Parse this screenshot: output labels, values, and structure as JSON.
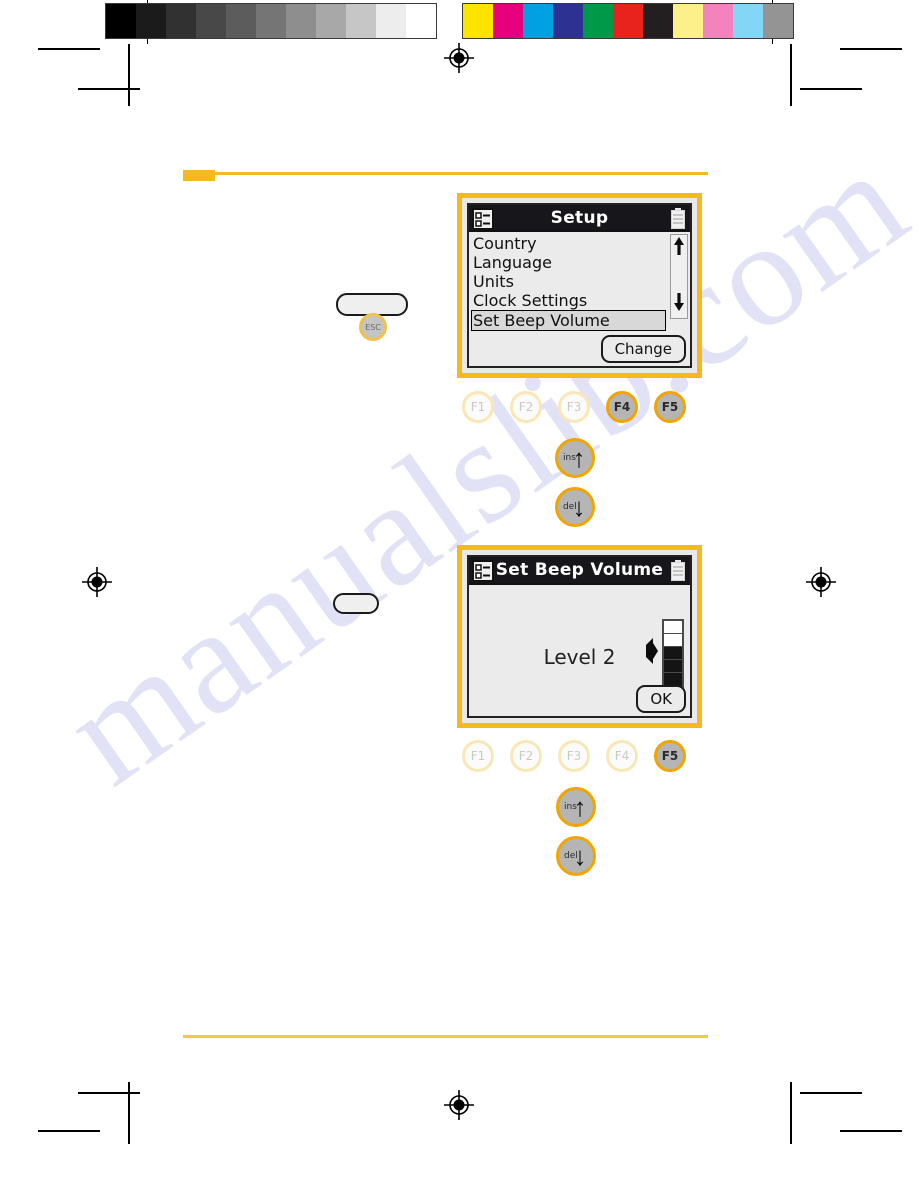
{
  "page": {
    "watermark_text": "manualslib.com"
  },
  "calibration": {
    "gray_swatches": [
      "#000000",
      "#1b1b1b",
      "#313131",
      "#484848",
      "#5c5c5c",
      "#757575",
      "#8e8e8e",
      "#a8a8a8",
      "#c6c6c6",
      "#ededed",
      "#ffffff"
    ],
    "color_swatches": [
      "#fde300",
      "#e6007e",
      "#00a0e3",
      "#2e3192",
      "#009949",
      "#e8221d",
      "#231f20",
      "#fcf08a",
      "#f283bd",
      "#84d6f7",
      "#949494"
    ]
  },
  "accent": {
    "yellow_rule": "#f5b820",
    "yellow_rule_bottom": "#f2cb3d",
    "device_frame": "#f5b820",
    "key_ring_active": "#f0a500",
    "key_ring_dim": "#fae7b4"
  },
  "screen1": {
    "title": "Setup",
    "icon_left": "checklist-icon",
    "icon_right": "battery-icon",
    "menu_items": [
      {
        "label": "Country",
        "selected": false
      },
      {
        "label": "Language",
        "selected": false
      },
      {
        "label": "Units",
        "selected": false
      },
      {
        "label": "Clock Settings",
        "selected": false
      },
      {
        "label": "Set Beep Volume",
        "selected": true
      }
    ],
    "scroll_up": "scroll-up-arrow",
    "scroll_down": "scroll-down-arrow",
    "softkey": "Change"
  },
  "screen2": {
    "title": "Set Beep Volume",
    "icon_left": "checklist-icon",
    "icon_right": "battery-icon",
    "value_label": "Level 2",
    "volume": {
      "total_segments": 5,
      "filled_segments": 3
    },
    "softkey": "OK"
  },
  "fkeys_row1": [
    {
      "label": "F1",
      "active": false
    },
    {
      "label": "F2",
      "active": false
    },
    {
      "label": "F3",
      "active": false
    },
    {
      "label": "F4",
      "active": true
    },
    {
      "label": "F5",
      "active": true
    }
  ],
  "fkeys_row2": [
    {
      "label": "F1",
      "active": false
    },
    {
      "label": "F2",
      "active": false
    },
    {
      "label": "F3",
      "active": false
    },
    {
      "label": "F4",
      "active": false
    },
    {
      "label": "F5",
      "active": true
    }
  ],
  "arrowkeys_row1": [
    {
      "label": "ins",
      "glyph": "↑"
    },
    {
      "label": "del",
      "glyph": "↓"
    }
  ],
  "arrowkeys_row2": [
    {
      "label": "ins",
      "glyph": "↑"
    },
    {
      "label": "del",
      "glyph": "↓"
    }
  ],
  "esckey": {
    "label": "ESC"
  }
}
